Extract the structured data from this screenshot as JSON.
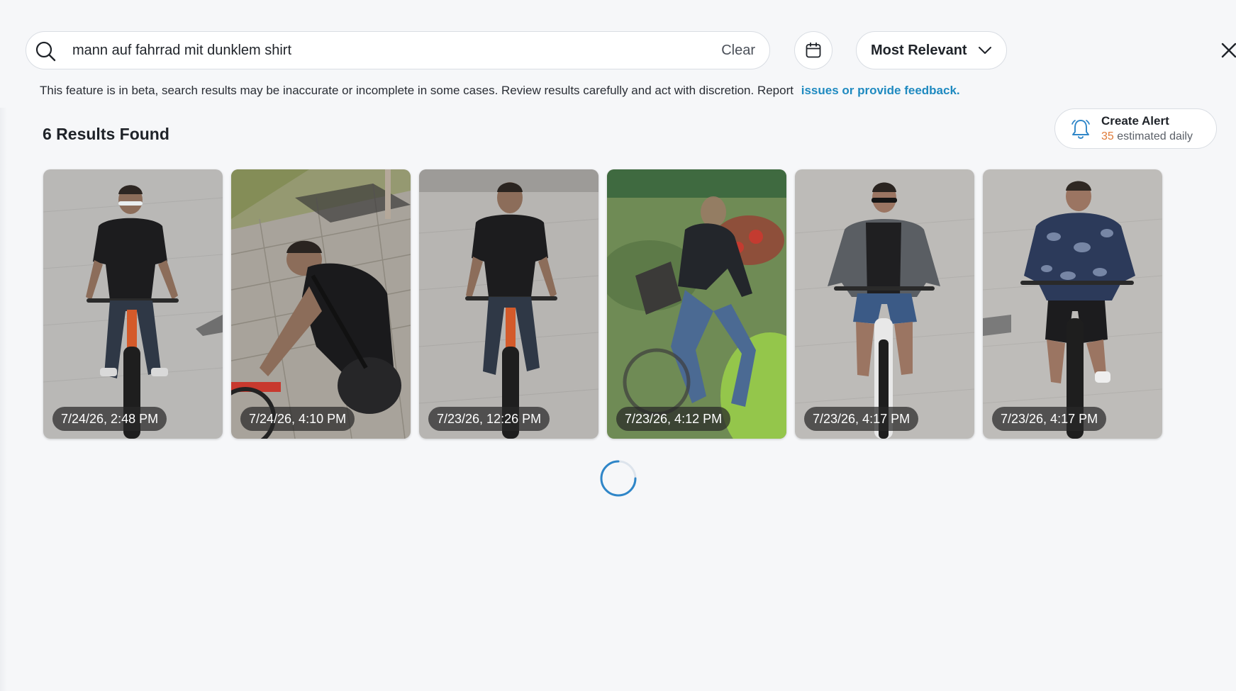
{
  "search": {
    "query": "mann auf fahrrad mit dunklem shirt",
    "clear_label": "Clear"
  },
  "sort": {
    "selected": "Most Relevant"
  },
  "notice": {
    "text": "This feature is in beta, search results may be inaccurate or incomplete in some cases. Review results carefully and act with discretion.  Report",
    "link_text": "issues or provide feedback."
  },
  "results": {
    "count_label": "6 Results Found",
    "items": [
      {
        "timestamp": "7/24/26, 2:48 PM"
      },
      {
        "timestamp": "7/24/26, 4:10 PM"
      },
      {
        "timestamp": "7/23/26, 12:26 PM"
      },
      {
        "timestamp": "7/23/26, 4:12 PM"
      },
      {
        "timestamp": "7/23/26, 4:17 PM"
      },
      {
        "timestamp": "7/23/26, 4:17 PM"
      }
    ]
  },
  "alert": {
    "title": "Create Alert",
    "count": "35",
    "suffix": "estimated daily"
  },
  "icons": {
    "search": "search-icon",
    "calendar": "calendar-icon",
    "dropdown": "chevron-down-icon",
    "close": "close-icon",
    "bell": "bell-icon",
    "spinner": "loading-spinner"
  },
  "colors": {
    "link": "#1f8ac0",
    "alert_count": "#e07b39",
    "spinner": "#2f86c8"
  }
}
